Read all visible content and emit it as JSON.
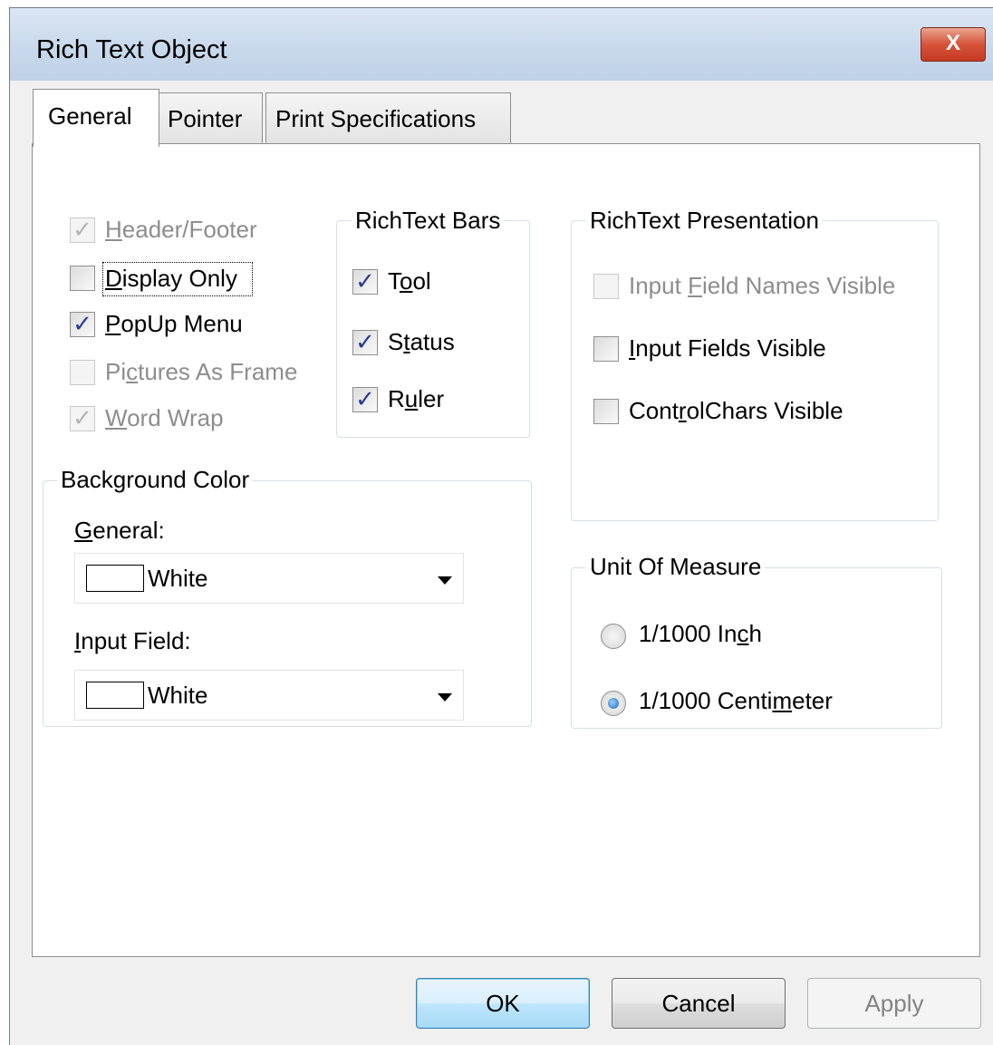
{
  "window": {
    "title": "Rich Text Object",
    "close_glyph": "X"
  },
  "tabs": [
    {
      "label": "General",
      "active": true
    },
    {
      "label": "Pointer",
      "active": false
    },
    {
      "label": "Print Specifications",
      "active": false
    }
  ],
  "general": {
    "options": [
      {
        "label_pre": "",
        "label_key": "H",
        "label_post": "eader/Footer",
        "checked": true,
        "disabled": true
      },
      {
        "label_pre": "",
        "label_key": "D",
        "label_post": "isplay Only",
        "checked": false,
        "disabled": false
      },
      {
        "label_pre": "",
        "label_key": "P",
        "label_post": "opUp Menu",
        "checked": true,
        "disabled": false
      },
      {
        "label_pre": "Pi",
        "label_key": "c",
        "label_post": "tures As Frame",
        "checked": false,
        "disabled": true
      },
      {
        "label_pre": "",
        "label_key": "W",
        "label_post": "ord Wrap",
        "checked": true,
        "disabled": true
      }
    ]
  },
  "richtext_bars": {
    "title": "RichText Bars",
    "items": [
      {
        "label_pre": "T",
        "label_key": "o",
        "label_post": "ol",
        "checked": true
      },
      {
        "label_pre": "S",
        "label_key": "t",
        "label_post": "atus",
        "checked": true
      },
      {
        "label_pre": "R",
        "label_key": "u",
        "label_post": "ler",
        "checked": true
      }
    ]
  },
  "richtext_presentation": {
    "title": "RichText Presentation",
    "items": [
      {
        "label_pre": "Input ",
        "label_key": "F",
        "label_post": "ield Names Visible",
        "checked": false,
        "disabled": true
      },
      {
        "label_pre": "",
        "label_key": "I",
        "label_post": "nput Fields Visible",
        "checked": false,
        "disabled": false
      },
      {
        "label_pre": "Cont",
        "label_key": "r",
        "label_post": "olChars Visible",
        "checked": false,
        "disabled": false
      }
    ]
  },
  "background_color": {
    "title": "Background Color",
    "general_label_key": "G",
    "general_label_post": "eneral:",
    "general_value": "White",
    "input_label_key": "I",
    "input_label_post": "nput Field:",
    "input_value": "White"
  },
  "unit_of_measure": {
    "title": "Unit Of Measure",
    "options": [
      {
        "label_pre": "1/1000 In",
        "label_key": "c",
        "label_post": "h",
        "selected": false
      },
      {
        "label_pre": "1/1000 Centi",
        "label_key": "m",
        "label_post": "eter",
        "selected": true
      }
    ]
  },
  "buttons": {
    "ok": "OK",
    "cancel": "Cancel",
    "apply": "Apply"
  },
  "colors": {
    "title_bar": "#c9d9ec",
    "close_button": "#d7543a",
    "default_button": "#bee6fd",
    "check_mark": "#2a3b8f"
  }
}
